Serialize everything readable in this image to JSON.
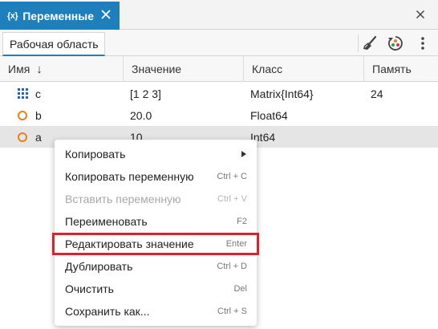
{
  "panel": {
    "icon_text": "{x}",
    "title": "Переменные"
  },
  "toolbar": {
    "workspace_tab": "Рабочая область"
  },
  "table": {
    "columns": [
      "Имя",
      "Значение",
      "Класс",
      "Память"
    ],
    "rows": [
      {
        "name": "c",
        "value": "[1 2 3]",
        "class": "Matrix{Int64}",
        "memory": "24",
        "icon": "matrix-icon"
      },
      {
        "name": "b",
        "value": "20.0",
        "class": "Float64",
        "memory": "",
        "icon": "scalar-icon"
      },
      {
        "name": "a",
        "value": "10",
        "class": "Int64",
        "memory": "",
        "icon": "scalar-icon"
      }
    ]
  },
  "context_menu": {
    "items": [
      {
        "label": "Копировать",
        "shortcut": "",
        "has_submenu": true,
        "disabled": false
      },
      {
        "label": "Копировать переменную",
        "shortcut": "Ctrl + C",
        "disabled": false
      },
      {
        "label": "Вставить переменную",
        "shortcut": "Ctrl + V",
        "disabled": true
      },
      {
        "label": "Переименовать",
        "shortcut": "F2",
        "disabled": false
      },
      {
        "label": "Редактировать значение",
        "shortcut": "Enter",
        "disabled": false,
        "highlighted": true
      },
      {
        "label": "Дублировать",
        "shortcut": "Ctrl + D",
        "disabled": false
      },
      {
        "label": "Очистить",
        "shortcut": "Del",
        "disabled": false
      },
      {
        "label": "Сохранить как...",
        "shortcut": "Ctrl + S",
        "disabled": false
      }
    ]
  },
  "colors": {
    "accent": "#1e7fbd",
    "highlight_border": "#e0202a",
    "scalar_icon": "#e8801e",
    "matrix_icon": "#1e63c8"
  }
}
